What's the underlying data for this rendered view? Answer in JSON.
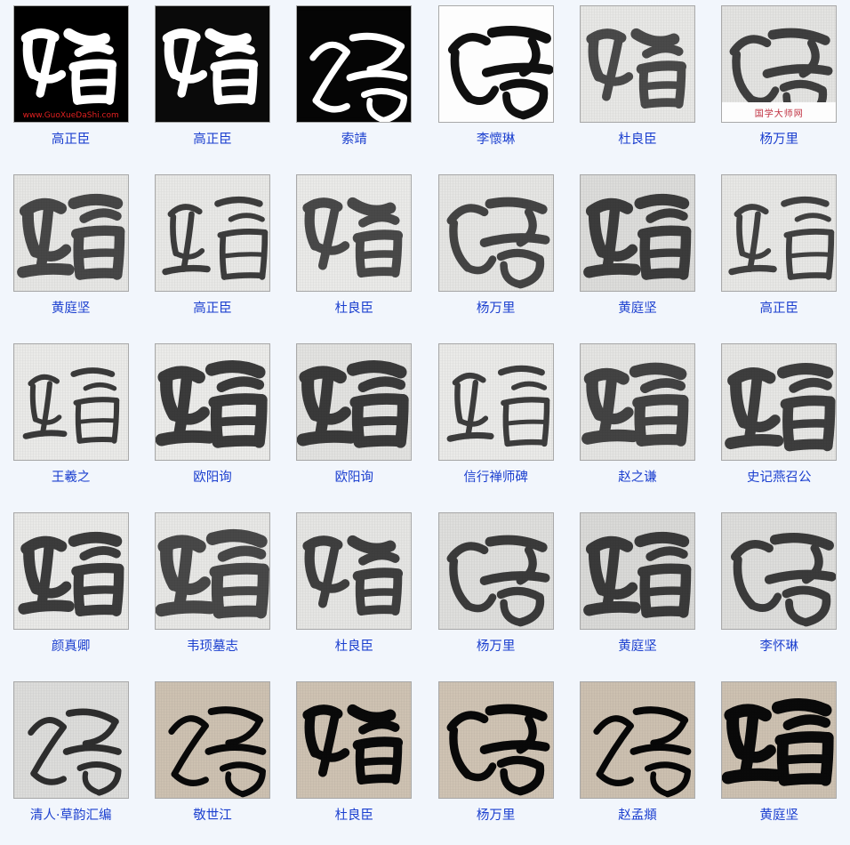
{
  "page": {
    "background_color": "#f2f6fc",
    "label_color": "#1b3fcf",
    "frame_color": "#a9a9a9",
    "columns": 6,
    "rows": 5,
    "character": "蹈"
  },
  "watermarks": {
    "latin": "www.GuoXueDaShi.com",
    "chinese": "国学大师网",
    "latin_color": "#e02020",
    "chinese_color": "#c03040"
  },
  "items": [
    {
      "label": "高正臣",
      "style": "inverted",
      "paper": "#000000",
      "ink": "#ffffff",
      "watermark": "latin",
      "glyph": "gaozhengchen-a"
    },
    {
      "label": "高正臣",
      "style": "inverted",
      "paper": "#0a0a0a",
      "ink": "#ffffff",
      "watermark": "none",
      "glyph": "gaozhengchen-b"
    },
    {
      "label": "索靖",
      "style": "inverted",
      "paper": "#050505",
      "ink": "#ffffff",
      "watermark": "none",
      "glyph": "suojing"
    },
    {
      "label": "李懷琳",
      "style": "normal",
      "paper": "#fdfdfd",
      "ink": "#101010",
      "watermark": "none",
      "glyph": "lihuailin-a"
    },
    {
      "label": "杜良臣",
      "style": "rubbing",
      "paper": "#e7e7e5",
      "ink": "#4a4a4a",
      "watermark": "none",
      "glyph": "duliangchen-a"
    },
    {
      "label": "杨万里",
      "style": "rubbing",
      "paper": "#e3e3e1",
      "ink": "#3f3f3f",
      "watermark": "chinese",
      "glyph": "yangwanli-a"
    },
    {
      "label": "黄庭坚",
      "style": "rubbing",
      "paper": "#e6e6e4",
      "ink": "#474747",
      "watermark": "none",
      "glyph": "huangtingjian-a"
    },
    {
      "label": "高正臣",
      "style": "rubbing",
      "paper": "#e8e8e6",
      "ink": "#3d3d3d",
      "watermark": "none",
      "glyph": "gaozhengchen-c"
    },
    {
      "label": "杜良臣",
      "style": "rubbing",
      "paper": "#eaeae8",
      "ink": "#494949",
      "watermark": "none",
      "glyph": "duliangchen-b"
    },
    {
      "label": "杨万里",
      "style": "rubbing",
      "paper": "#e5e5e3",
      "ink": "#444444",
      "watermark": "none",
      "glyph": "yangwanli-b"
    },
    {
      "label": "黄庭坚",
      "style": "rubbing",
      "paper": "#dcdcda",
      "ink": "#3c3c3c",
      "watermark": "none",
      "glyph": "huangtingjian-b"
    },
    {
      "label": "高正臣",
      "style": "rubbing",
      "paper": "#e7e7e5",
      "ink": "#414141",
      "watermark": "none",
      "glyph": "gaozhengchen-d"
    },
    {
      "label": "王羲之",
      "style": "rubbing",
      "paper": "#eaeae8",
      "ink": "#3a3a3a",
      "watermark": "none",
      "glyph": "wangxizhi"
    },
    {
      "label": "欧阳询",
      "style": "rubbing",
      "paper": "#ebebe9",
      "ink": "#3b3b3b",
      "watermark": "none",
      "glyph": "ouyangxun-a"
    },
    {
      "label": "欧阳询",
      "style": "rubbing",
      "paper": "#e2e2e0",
      "ink": "#3a3a3a",
      "watermark": "none",
      "glyph": "ouyangxun-b"
    },
    {
      "label": "信行禅师碑",
      "style": "rubbing",
      "paper": "#eaeae8",
      "ink": "#3d3d3d",
      "watermark": "none",
      "glyph": "xinxing"
    },
    {
      "label": "赵之谦",
      "style": "rubbing",
      "paper": "#e4e4e2",
      "ink": "#434343",
      "watermark": "none",
      "glyph": "zhaozhiqian"
    },
    {
      "label": "史记燕召公",
      "style": "rubbing",
      "paper": "#e6e6e4",
      "ink": "#3e3e3e",
      "watermark": "none",
      "glyph": "shijiyanshaogong"
    },
    {
      "label": "颜真卿",
      "style": "rubbing",
      "paper": "#e9e9e7",
      "ink": "#3c3c3c",
      "watermark": "none",
      "glyph": "yanzhenqing"
    },
    {
      "label": "韦顼墓志",
      "style": "rubbing",
      "paper": "#e7e7e5",
      "ink": "#484848",
      "watermark": "none",
      "glyph": "weixumuzhi"
    },
    {
      "label": "杜良臣",
      "style": "rubbing",
      "paper": "#e5e5e3",
      "ink": "#3f3f3f",
      "watermark": "none",
      "glyph": "duliangchen-c"
    },
    {
      "label": "杨万里",
      "style": "rubbing",
      "paper": "#dededc",
      "ink": "#3b3b3b",
      "watermark": "none",
      "glyph": "yangwanli-c"
    },
    {
      "label": "黄庭坚",
      "style": "rubbing",
      "paper": "#d9d9d7",
      "ink": "#3a3a3a",
      "watermark": "none",
      "glyph": "huangtingjian-c"
    },
    {
      "label": "李怀琳",
      "style": "rubbing",
      "paper": "#dddddb",
      "ink": "#3b3b3b",
      "watermark": "none",
      "glyph": "lihuailin-b"
    },
    {
      "label": "清人·草韵汇编",
      "style": "rubbing",
      "paper": "#dcdcda",
      "ink": "#2e2e2e",
      "watermark": "none",
      "glyph": "qingren"
    },
    {
      "label": "敬世江",
      "style": "paper",
      "paper": "#cdc1b1",
      "ink": "#0a0a0a",
      "watermark": "none",
      "glyph": "jingshijiang"
    },
    {
      "label": "杜良臣",
      "style": "paper",
      "paper": "#cec2b2",
      "ink": "#0a0a0a",
      "watermark": "none",
      "glyph": "duliangchen-d"
    },
    {
      "label": "杨万里",
      "style": "paper",
      "paper": "#cfc3b3",
      "ink": "#090909",
      "watermark": "none",
      "glyph": "yangwanli-d"
    },
    {
      "label": "赵孟頫",
      "style": "paper",
      "paper": "#ccc0b0",
      "ink": "#080808",
      "watermark": "none",
      "glyph": "zhaomengfu"
    },
    {
      "label": "黄庭坚",
      "style": "paper",
      "paper": "#cdc1b1",
      "ink": "#0a0a0a",
      "watermark": "none",
      "glyph": "huangtingjian-d"
    }
  ]
}
